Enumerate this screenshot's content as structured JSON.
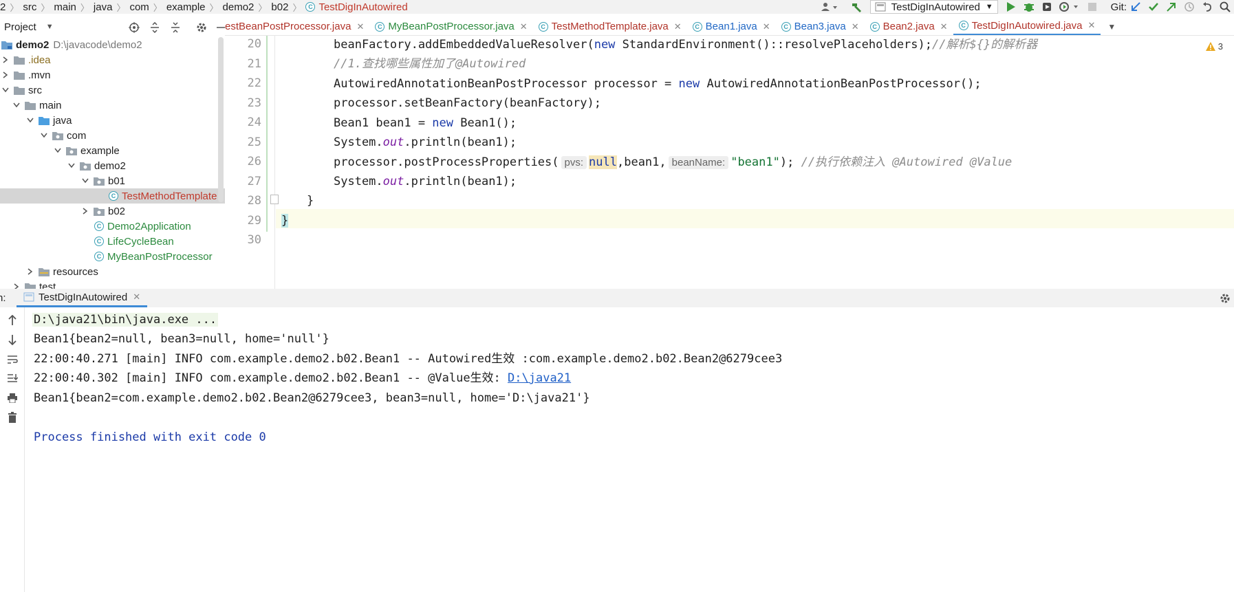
{
  "navbar": {
    "breadcrumbs": [
      "2",
      "src",
      "main",
      "java",
      "com",
      "example",
      "demo2",
      "b02"
    ],
    "current_file": "TestDigInAutowired",
    "run_config": "TestDigInAutowired",
    "git_label": "Git:"
  },
  "project_panel": {
    "title": "Project",
    "tree": [
      {
        "label": "demo2",
        "extra": "D:\\javacode\\demo2",
        "depth": 0,
        "type": "module",
        "expanded": true
      },
      {
        "label": ".idea",
        "depth": 1,
        "type": "folder",
        "expanded": false
      },
      {
        "label": ".mvn",
        "depth": 1,
        "type": "folder",
        "expanded": false
      },
      {
        "label": "src",
        "depth": 1,
        "type": "folder",
        "expanded": true
      },
      {
        "label": "main",
        "depth": 2,
        "type": "folder",
        "expanded": true
      },
      {
        "label": "java",
        "depth": 3,
        "type": "source-folder",
        "expanded": true
      },
      {
        "label": "com",
        "depth": 4,
        "type": "package",
        "expanded": true
      },
      {
        "label": "example",
        "depth": 5,
        "type": "package",
        "expanded": true
      },
      {
        "label": "demo2",
        "depth": 6,
        "type": "package",
        "expanded": true
      },
      {
        "label": "b01",
        "depth": 7,
        "type": "package",
        "expanded": true
      },
      {
        "label": "TestMethodTemplate",
        "depth": 8,
        "type": "class-red",
        "selected": true
      },
      {
        "label": "b02",
        "depth": 7,
        "type": "package",
        "expanded": false
      },
      {
        "label": "Demo2Application",
        "depth": 7,
        "type": "class-green"
      },
      {
        "label": "LifeCycleBean",
        "depth": 7,
        "type": "class-green"
      },
      {
        "label": "MyBeanPostProcessor",
        "depth": 7,
        "type": "class-green"
      },
      {
        "label": "resources",
        "depth": 3,
        "type": "resource-folder",
        "expanded": false
      },
      {
        "label": "test",
        "depth": 2,
        "type": "folder",
        "expanded": false
      }
    ]
  },
  "editor_tabs": [
    {
      "label": "estBeanPostProcessor.java",
      "color": "red"
    },
    {
      "label": "MyBeanPostProcessor.java",
      "color": "green"
    },
    {
      "label": "TestMethodTemplate.java",
      "color": "red"
    },
    {
      "label": "Bean1.java",
      "color": "blue"
    },
    {
      "label": "Bean3.java",
      "color": "blue"
    },
    {
      "label": "Bean2.java",
      "color": "red"
    },
    {
      "label": "TestDigInAutowired.java",
      "color": "red",
      "active": true
    }
  ],
  "editor": {
    "warning_count": "3",
    "line_numbers": [
      "20",
      "21",
      "22",
      "23",
      "24",
      "25",
      "26",
      "27",
      "28",
      "29",
      "30"
    ],
    "lines": {
      "l20_a": "beanFactory.addEmbeddedValueResolver(",
      "l20_kw": "new",
      "l20_b": " StandardEnvironment()::resolvePlaceholders);",
      "l20_cmt": "//解析${}的解析器",
      "l21_cmt": "//1.查找哪些属性加了@Autowired",
      "l22_a": "AutowiredAnnotationBeanPostProcessor processor = ",
      "l22_kw": "new",
      "l22_b": " AutowiredAnnotationBeanPostProcessor();",
      "l23": "processor.setBeanFactory(beanFactory);",
      "l24_a": "Bean1 bean1 = ",
      "l24_kw": "new",
      "l24_b": " Bean1();",
      "l25_a": "System.",
      "l25_fld": "out",
      "l25_b": ".println(bean1);",
      "l26_a": "processor.postProcessProperties(",
      "l26_hint1": "pvs:",
      "l26_null": "null",
      "l26_b": ",bean1,",
      "l26_hint2": "beanName:",
      "l26_str": "\"bean1\"",
      "l26_c": "); ",
      "l26_cmt": "//执行依赖注入 @Autowired @Value",
      "l27_a": "System.",
      "l27_fld": "out",
      "l27_b": ".println(bean1);",
      "l28": "}",
      "l29": "}"
    }
  },
  "run_panel": {
    "prefix": "n:",
    "tab_label": "TestDigInAutowired",
    "console": {
      "cmd": "D:\\java21\\bin\\java.exe ...",
      "line1": "Bean1{bean2=null, bean3=null, home='null'}",
      "line2": "22:00:40.271 [main] INFO com.example.demo2.b02.Bean1 -- Autowired生效 :com.example.demo2.b02.Bean2@6279cee3",
      "line3_a": "22:00:40.302 [main] INFO com.example.demo2.b02.Bean1 -- @Value生效: ",
      "line3_link": "D:\\java21",
      "line4": "Bean1{bean2=com.example.demo2.b02.Bean2@6279cee3, bean3=null, home='D:\\java21'}",
      "exit": "Process finished with exit code 0"
    }
  }
}
